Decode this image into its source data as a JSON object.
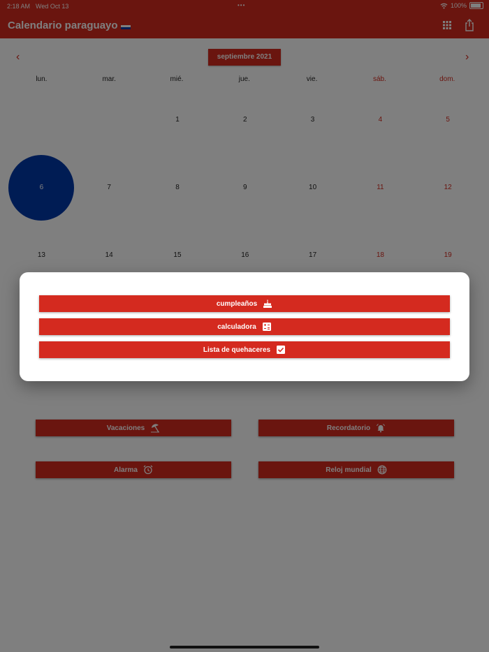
{
  "status_bar": {
    "time": "2:18 AM",
    "date": "Wed Oct 13",
    "battery": "100%"
  },
  "app_bar": {
    "title": "Calendario paraguayo"
  },
  "calendar": {
    "month": "septiembre 2021",
    "weekdays": [
      "lun.",
      "mar.",
      "mié.",
      "jue.",
      "vie.",
      "sáb.",
      "dom."
    ],
    "weeks": [
      [
        "",
        "",
        "1",
        "2",
        "3",
        "4",
        "5"
      ],
      [
        "6",
        "7",
        "8",
        "9",
        "10",
        "11",
        "12"
      ],
      [
        "13",
        "14",
        "15",
        "16",
        "17",
        "18",
        "19"
      ]
    ],
    "selected_day": "6"
  },
  "actions": {
    "vacaciones": "Vacaciones",
    "recordatorio": "Recordatorio",
    "alarma": "Alarma",
    "reloj_mundial": "Reloj mundial"
  },
  "dialog": {
    "items": [
      "cumpleaños",
      "calculadora",
      "Lista de quehaceres"
    ]
  },
  "colors": {
    "accent": "#d42a1f",
    "today": "#0038a8"
  }
}
